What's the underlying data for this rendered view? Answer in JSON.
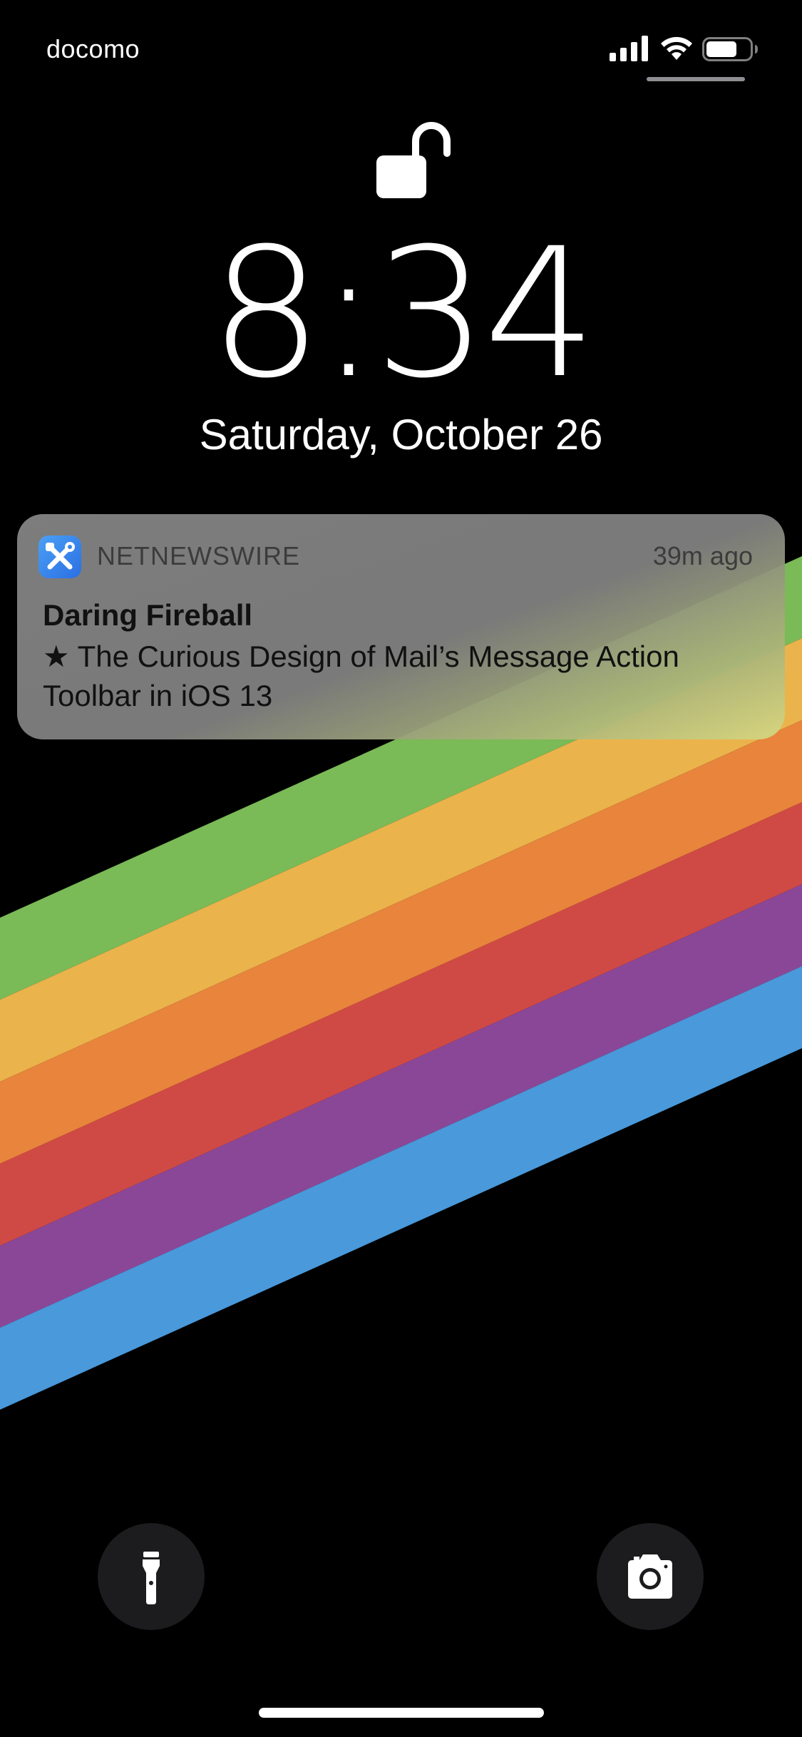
{
  "status_bar": {
    "carrier": "docomo",
    "signal_icon": "cellular-signal-icon",
    "wifi_icon": "wifi-icon",
    "battery_icon": "battery-icon"
  },
  "lock": {
    "icon": "unlocked-padlock-icon",
    "time": "8:34",
    "date": "Saturday, October 26"
  },
  "notification": {
    "app_icon": "netnewswire-app-icon",
    "app_name": "NETNEWSWIRE",
    "time_ago": "39m ago",
    "title": "Daring Fireball",
    "body": "★ The Curious Design of Mail’s Message Action Toolbar in iOS 13"
  },
  "quick_actions": {
    "flashlight_icon": "flashlight-icon",
    "camera_icon": "camera-icon"
  },
  "wallpaper": {
    "stripe_colors": [
      "#7aba57",
      "#ebb34b",
      "#e8843c",
      "#d04a45",
      "#8b4797",
      "#4999db"
    ]
  }
}
